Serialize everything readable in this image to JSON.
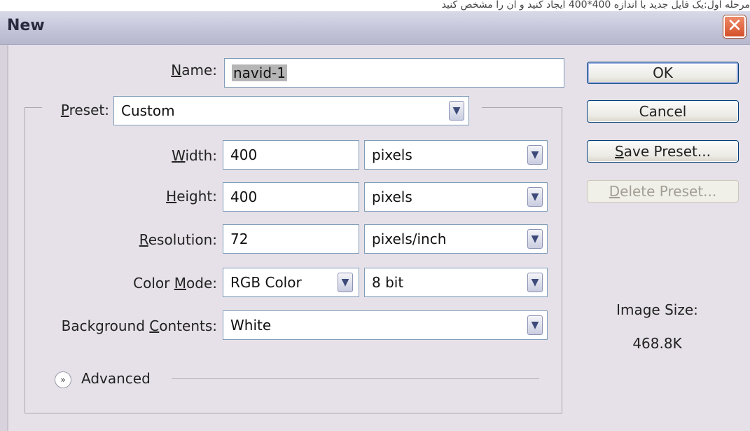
{
  "caption": "مرحله اول:یک فایل جدید با اندازه 400*400 ایجاد کنید و ان را مشخص کنید",
  "window": {
    "title": "New",
    "close_glyph": "✕"
  },
  "form": {
    "name_label": "Name:",
    "name_value": "navid-1",
    "preset_label": "Preset:",
    "preset_value": "Custom",
    "width_label": "Width:",
    "width_value": "400",
    "width_unit": "pixels",
    "height_label": "Height:",
    "height_value": "400",
    "height_unit": "pixels",
    "resolution_label": "Resolution:",
    "resolution_value": "72",
    "resolution_unit": "pixels/inch",
    "color_mode_label": "Color Mode:",
    "color_mode_value": "RGB Color",
    "bit_depth_value": "8 bit",
    "background_label": "Background Contents:",
    "background_value": "White",
    "advanced_label": "Advanced"
  },
  "buttons": {
    "ok": "OK",
    "cancel": "Cancel",
    "save_preset": "Save Preset...",
    "delete_preset": "Delete Preset..."
  },
  "info": {
    "image_size_label": "Image Size:",
    "image_size_value": "468.8K"
  },
  "icons": {
    "dropdown": "chevron-down-icon",
    "advanced": "double-chevron-down-icon",
    "close": "close-icon"
  },
  "colors": {
    "close_button": "#d4502a",
    "dialog_bg": "#e6e1e8",
    "field_border": "#7f9db9"
  }
}
